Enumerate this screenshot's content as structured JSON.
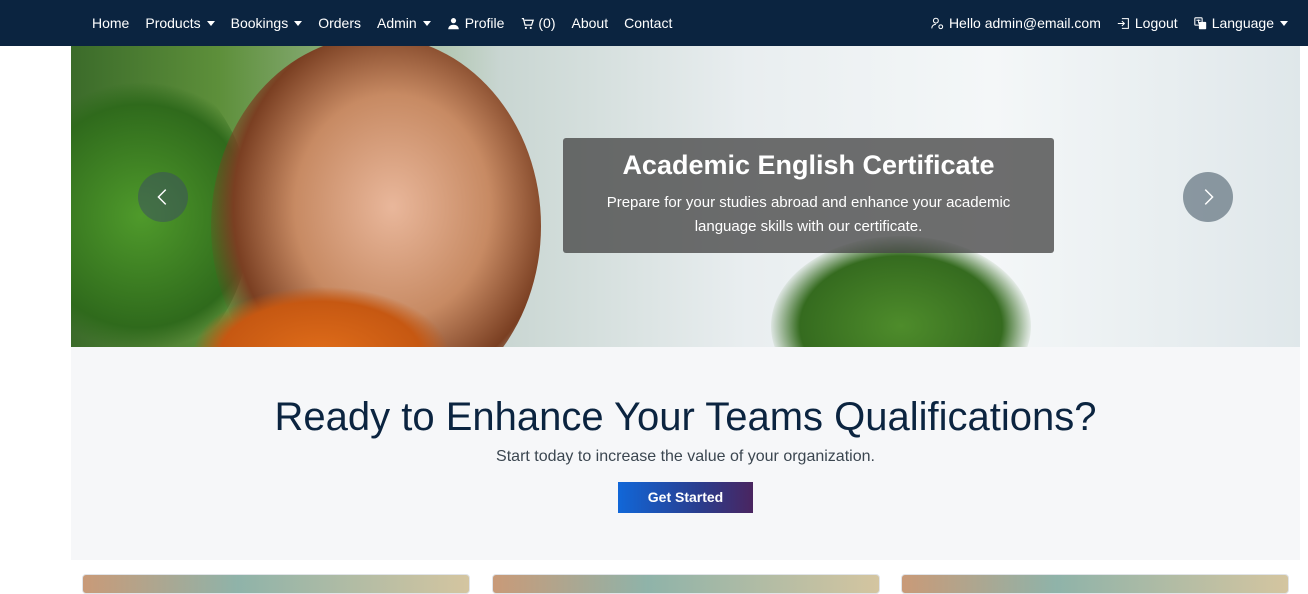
{
  "navbar": {
    "left_items": [
      {
        "label": "Home",
        "dropdown": false,
        "icon": ""
      },
      {
        "label": "Products",
        "dropdown": true,
        "icon": ""
      },
      {
        "label": "Bookings",
        "dropdown": true,
        "icon": ""
      },
      {
        "label": "Orders",
        "dropdown": false,
        "icon": ""
      },
      {
        "label": "Admin",
        "dropdown": true,
        "icon": ""
      },
      {
        "label": "Profile",
        "dropdown": false,
        "icon": "person-icon"
      },
      {
        "label": "(0)",
        "dropdown": false,
        "icon": "cart-icon"
      },
      {
        "label": "About",
        "dropdown": false,
        "icon": ""
      },
      {
        "label": "Contact",
        "dropdown": false,
        "icon": ""
      }
    ],
    "greeting": "Hello admin@email.com",
    "logout_label": "Logout",
    "language_label": "Language"
  },
  "hero": {
    "title": "Academic English Certificate",
    "text": "Prepare for your studies abroad and enhance your academic language skills with our certificate."
  },
  "cta": {
    "title": "Ready to Enhance Your Teams Qualifications?",
    "subtitle": "Start today to increase the value of your organization.",
    "button_label": "Get Started"
  },
  "colors": {
    "navbar_bg": "#0b2440",
    "cta_bg": "#f6f7f9",
    "button_gradient_start": "#1167d8",
    "button_gradient_end": "#4a2560"
  }
}
